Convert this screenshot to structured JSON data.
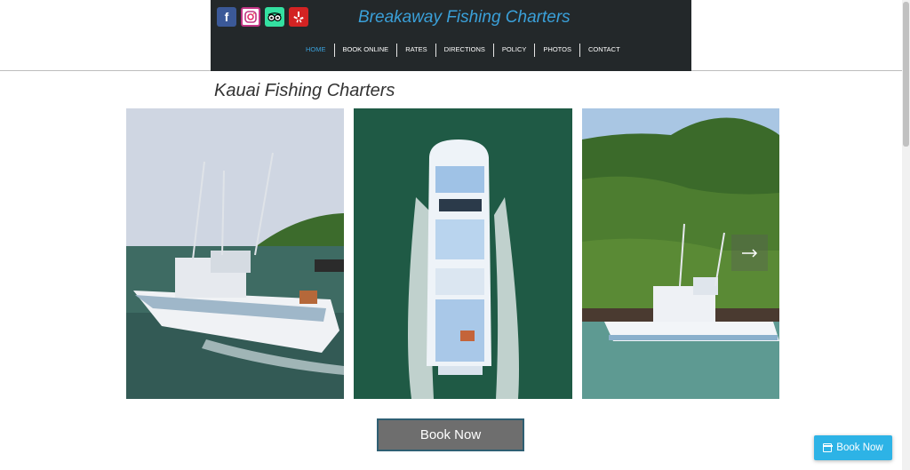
{
  "header": {
    "title": "Breakaway Fishing Charters",
    "social": [
      {
        "name": "facebook-icon",
        "glyph": "f"
      },
      {
        "name": "instagram-icon",
        "glyph": ""
      },
      {
        "name": "tripadvisor-icon",
        "glyph": ""
      },
      {
        "name": "yelp-icon",
        "glyph": ""
      }
    ]
  },
  "nav": {
    "home": "HOME",
    "book_online": "BOOK ONLINE",
    "rates": "RATES",
    "directions": "DIRECTIONS",
    "policy": "POLICY",
    "photos": "PHOTOS",
    "contact": "CONTACT"
  },
  "main": {
    "heading": "Kauai Fishing Charters",
    "book_button": "Book Now"
  },
  "float": {
    "book_button": "Book Now"
  },
  "colors": {
    "header_bg": "#23282a",
    "accent": "#3aa0d9",
    "button_gray": "#6e6e6e",
    "float_button": "#2db3e6"
  }
}
